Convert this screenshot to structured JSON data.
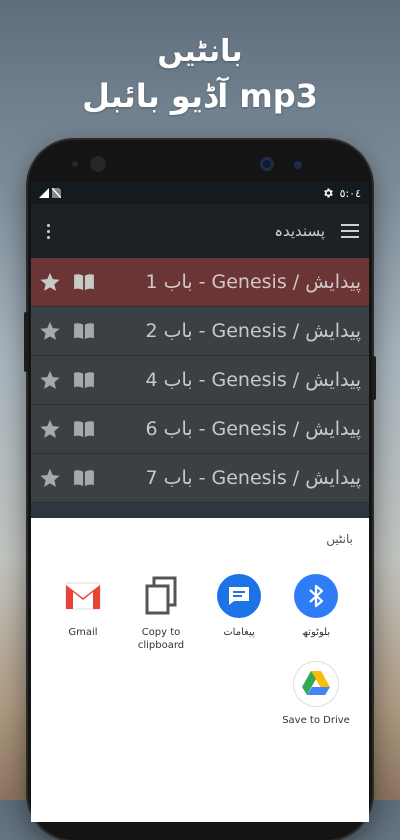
{
  "headline": {
    "line1": "بانٹیں",
    "line2": "mp3 آڈیو بائبل"
  },
  "status_bar": {
    "time": "٥:٠٤"
  },
  "toolbar": {
    "title": "پسندیدہ"
  },
  "favorites": [
    {
      "title": "پیدایش / Genesis - باب 1",
      "highlighted": true
    },
    {
      "title": "پیدایش / Genesis - باب 2",
      "highlighted": false
    },
    {
      "title": "پیدایش / Genesis - باب 4",
      "highlighted": false
    },
    {
      "title": "پیدایش / Genesis - باب 6",
      "highlighted": false
    },
    {
      "title": "پیدایش / Genesis - باب 7",
      "highlighted": false
    }
  ],
  "share_sheet": {
    "title": "بانٹیں",
    "targets": [
      {
        "label": "بلوٹوتھ",
        "icon": "bluetooth-icon",
        "color": "#2f7df6"
      },
      {
        "label": "پیغامات",
        "icon": "messages-icon",
        "color": "#1c73e8"
      },
      {
        "label": "Copy to\nclipboard",
        "icon": "copy-icon",
        "color": "#ffffff"
      },
      {
        "label": "Gmail",
        "icon": "gmail-icon",
        "color": "#ffffff"
      },
      {
        "label": "Save to Drive",
        "icon": "drive-icon",
        "color": "#ffffff"
      }
    ]
  },
  "colors": {
    "highlight_row": "#6b3536",
    "toolbar": "#1c2123",
    "list_row": "#3b4045"
  }
}
